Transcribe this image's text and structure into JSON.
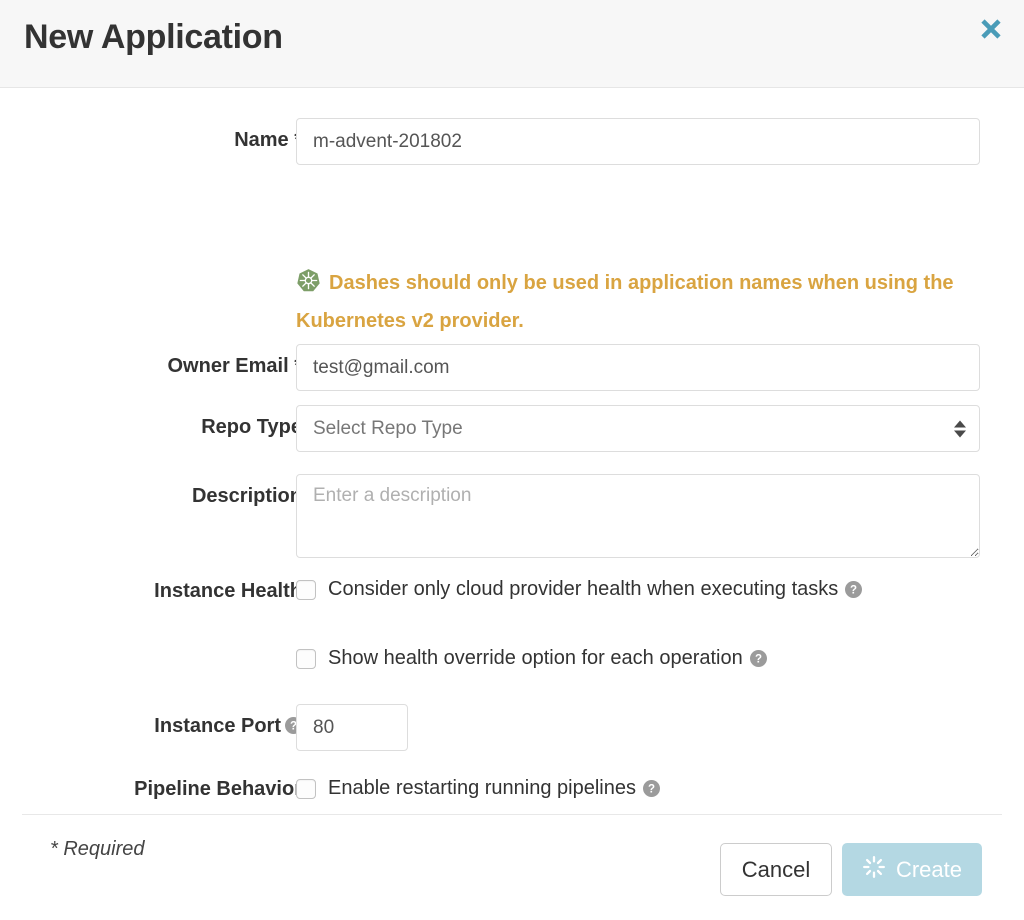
{
  "header": {
    "title": "New Application",
    "close_icon": "close-icon"
  },
  "form": {
    "name": {
      "label": "Name *",
      "value": "m-advent-201802",
      "placeholder": ""
    },
    "name_warning": {
      "icon": "kubernetes-icon",
      "text": "Dashes should only be used in application names when using the Kubernetes v2 provider.",
      "color": "#d9a441"
    },
    "owner_email": {
      "label": "Owner Email *",
      "value": "test@gmail.com",
      "placeholder": ""
    },
    "repo_type": {
      "label": "Repo Type",
      "selected": "Select Repo Type",
      "options": [
        "Select Repo Type"
      ]
    },
    "description": {
      "label": "Description",
      "value": "",
      "placeholder": "Enter a description"
    },
    "instance_health": {
      "label": "Instance Health",
      "checkboxes": [
        {
          "label": "Consider only cloud provider health when executing tasks",
          "checked": false,
          "help_icon": "help-icon"
        },
        {
          "label": "Show health override option for each operation",
          "checked": false,
          "help_icon": "help-icon"
        }
      ]
    },
    "instance_port": {
      "label": "Instance Port",
      "help_icon": "help-icon",
      "value": "80",
      "placeholder": ""
    },
    "pipeline_behavior": {
      "label": "Pipeline Behavior",
      "checkbox": {
        "label": "Enable restarting running pipelines",
        "checked": false,
        "help_icon": "help-icon"
      }
    },
    "required_note": "* Required"
  },
  "footer": {
    "cancel_label": "Cancel",
    "create_label": "Create",
    "create_disabled": true,
    "create_spinner_icon": "spinner-icon",
    "create_bg": "#b4d8e3"
  }
}
